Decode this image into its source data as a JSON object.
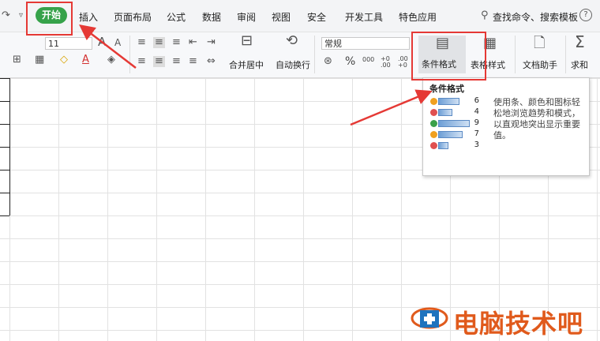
{
  "menu": {
    "home": "开始",
    "insert": "插入",
    "page_layout": "页面布局",
    "formulas": "公式",
    "data": "数据",
    "review": "审阅",
    "view": "视图",
    "security": "安全",
    "developer": "开发工具",
    "special": "特色应用",
    "search": "查找命令、搜索模板"
  },
  "ribbon": {
    "font_size": "11",
    "number_format": "常规",
    "merge_center": "合并居中",
    "wrap_text": "自动换行",
    "conditional_format": "条件格式",
    "table_style": "表格样式",
    "doc_assistant": "文档助手",
    "sum": "求和",
    "percent": "%",
    "thousands": "000",
    "inc_decimal": "+0 .00",
    "dec_decimal": ".00 +0"
  },
  "tooltip": {
    "title": "条件格式",
    "description": "使用条、颜色和图标轻松地浏览趋势和模式，以直观地突出显示重要值。",
    "rows": [
      {
        "value": "6",
        "fill": 0.67,
        "icon_color": "#f0a020"
      },
      {
        "value": "4",
        "fill": 0.44,
        "icon_color": "#e05050"
      },
      {
        "value": "9",
        "fill": 1.0,
        "icon_color": "#3aa04a"
      },
      {
        "value": "7",
        "fill": 0.78,
        "icon_color": "#f0a020"
      },
      {
        "value": "3",
        "fill": 0.33,
        "icon_color": "#e05050"
      }
    ]
  },
  "watermark": "电脑技术吧",
  "colors": {
    "home_tab": "#36a24a",
    "annotation": "#e53935",
    "watermark": "#e05a1c"
  }
}
